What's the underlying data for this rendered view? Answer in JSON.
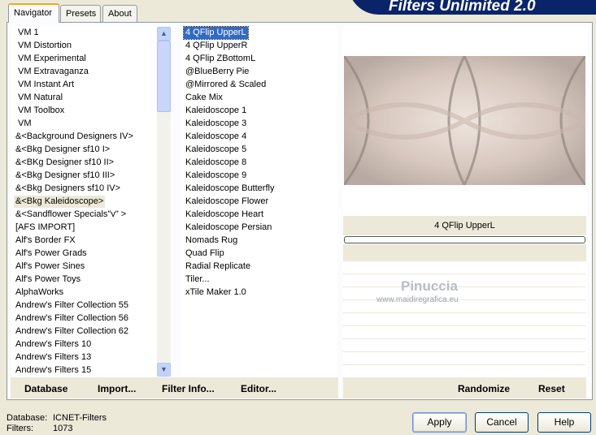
{
  "app": {
    "title": "Filters Unlimited 2.0"
  },
  "tabs": [
    {
      "label": "Navigator"
    },
    {
      "label": "Presets"
    },
    {
      "label": "About"
    }
  ],
  "categories": [
    "VM 1",
    "VM Distortion",
    "VM Experimental",
    "VM Extravaganza",
    "VM Instant Art",
    "VM Natural",
    "VM Toolbox",
    "VM",
    "&<Background Designers IV>",
    "&<Bkg Designer sf10 I>",
    "&<BKg Designer sf10 II>",
    "&<Bkg Designer sf10 III>",
    "&<Bkg Designers sf10 IV>",
    "&<Bkg Kaleidoscope>",
    "&<Sandflower Specials\"v\" >",
    "[AFS IMPORT]",
    "Alf's Border FX",
    "Alf's Power Grads",
    "Alf's Power Sines",
    "Alf's Power Toys",
    "AlphaWorks",
    "Andrew's Filter Collection 55",
    "Andrew's Filter Collection 56",
    "Andrew's Filter Collection 62",
    "Andrew's Filters 10",
    "Andrew's Filters 13",
    "Andrew's Filters 15"
  ],
  "selected_category": "&<Bkg Kaleidoscope>",
  "filters": [
    "4 QFlip UpperL",
    "4 QFlip UpperR",
    "4 QFlip ZBottomL",
    "@BlueBerry Pie",
    "@Mirrored & Scaled",
    "Cake Mix",
    "Kaleidoscope 1",
    "Kaleidoscope 3",
    "Kaleidoscope 4",
    "Kaleidoscope 5",
    "Kaleidoscope 8",
    "Kaleidoscope 9",
    "Kaleidoscope Butterfly",
    "Kaleidoscope Flower",
    "Kaleidoscope Heart",
    "Kaleidoscope Persian",
    "Nomads Rug",
    "Quad Flip",
    "Radial Replicate",
    "Tiler...",
    "xTile Maker 1.0"
  ],
  "selected_filter": "4 QFlip UpperL",
  "preview": {
    "filter_name": "4 QFlip UpperL",
    "progress": 0,
    "watermark": "Pinuccia",
    "watermark_url": "www.maidiregrafica.eu"
  },
  "left_buttons": {
    "database": "Database",
    "import": "Import...",
    "filter_info": "Filter Info...",
    "editor": "Editor..."
  },
  "right_buttons": {
    "randomize": "Randomize",
    "reset": "Reset"
  },
  "status": {
    "database_label": "Database:",
    "database_value": "ICNET-Filters",
    "filters_label": "Filters:",
    "filters_value": "1073"
  },
  "dialog_buttons": {
    "apply": "Apply",
    "cancel": "Cancel",
    "help": "Help"
  }
}
